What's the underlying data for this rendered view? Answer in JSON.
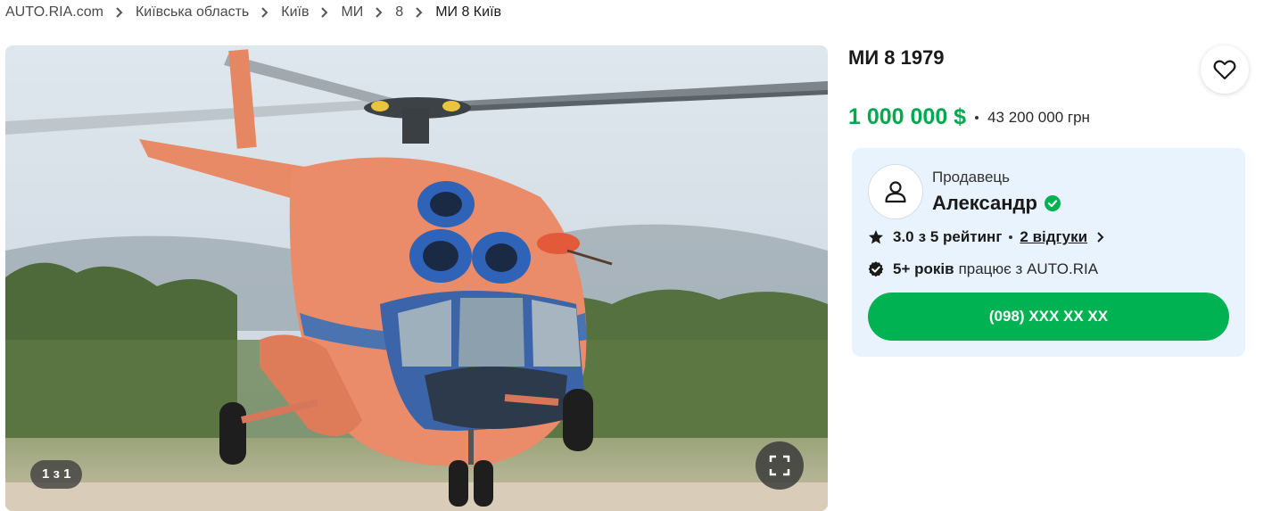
{
  "breadcrumb": {
    "items": [
      "AUTO.RIA.com",
      "Київська область",
      "Київ",
      "МИ",
      "8"
    ],
    "current": "МИ 8 Київ"
  },
  "gallery": {
    "counter": "1 з 1",
    "fullscreen_icon": "fullscreen-icon"
  },
  "listing": {
    "title": "МИ 8 1979",
    "price_usd": "1 000 000 $",
    "price_uah": "43 200 000 грн",
    "favorite_icon": "heart-icon"
  },
  "seller": {
    "label": "Продавець",
    "name": "Александр",
    "verified_icon": "verified-check-icon",
    "rating_value": "3.0",
    "rating_suffix": "з 5 рейтинг",
    "reviews": "2 відгуки",
    "years_strong": "5+ років",
    "years_rest": "працює з AUTO.RIA",
    "phone": "(098) XXX XX XX"
  },
  "colors": {
    "accent_green": "#00b251",
    "price_green": "#00a94f",
    "seller_card_bg": "#e8f3fd"
  }
}
